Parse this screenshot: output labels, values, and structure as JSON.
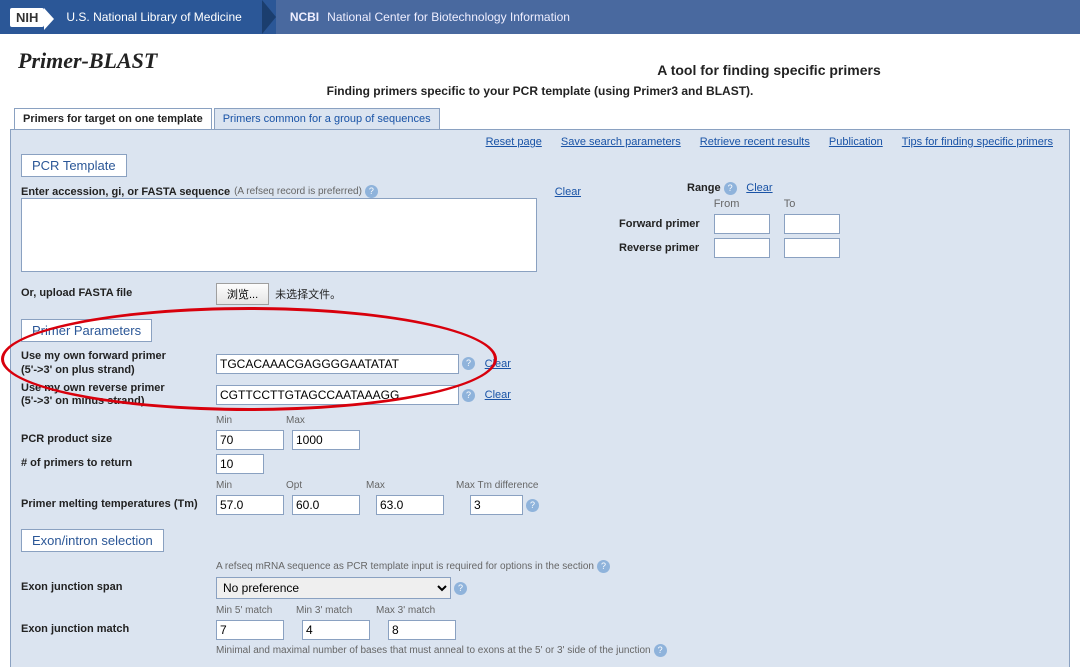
{
  "topbar": {
    "nih": "NIH",
    "nlm": "U.S. National Library of Medicine",
    "ncbi_bold": "NCBI",
    "ncbi": "National Center for Biotechnology Information"
  },
  "page": {
    "title": "Primer-BLAST",
    "subtitle": "A tool for finding specific primers",
    "tagline": "Finding primers specific to your PCR template (using Primer3 and BLAST)."
  },
  "tabs": {
    "active": "Primers for target on one template",
    "other": "Primers common for a group of sequences"
  },
  "quicklinks": [
    "Reset page",
    "Save search parameters",
    "Retrieve recent results",
    "Publication",
    "Tips for finding specific primers"
  ],
  "sections": {
    "pcr_template": "PCR Template",
    "primer_params": "Primer Parameters",
    "exon": "Exon/intron selection"
  },
  "template": {
    "label": "Enter accession, gi, or FASTA sequence",
    "hint": "(A refseq record is preferred)",
    "clear": "Clear",
    "upload_label": "Or, upload FASTA file",
    "browse": "浏览...",
    "nofile": "未选择文件。",
    "range_label": "Range",
    "range_clear": "Clear",
    "from": "From",
    "to": "To",
    "fwd": "Forward primer",
    "rev": "Reverse primer"
  },
  "primers": {
    "fwd_label": "Use my own forward primer\n(5'->3' on plus strand)",
    "rev_label": "Use my own reverse primer\n(5'->3' on minus strand)",
    "fwd_value": "TGCACAAACGAGGGGAATATAT",
    "rev_value": "CGTTCCTTGTAGCCAATAAAGG",
    "clear": "Clear",
    "size_label": "PCR product size",
    "min": "Min",
    "max": "Max",
    "size_min": "70",
    "size_max": "1000",
    "count_label": "# of primers to return",
    "count": "10",
    "tm_label": "Primer melting temperatures (Tm)",
    "opt": "Opt",
    "maxdiff": "Max Tm difference",
    "tm_min": "57.0",
    "tm_opt": "60.0",
    "tm_max": "63.0",
    "tm_diff": "3"
  },
  "exon": {
    "note": "A refseq mRNA sequence as PCR template input is required for options in the section",
    "span_label": "Exon junction span",
    "span_value": "No preference",
    "match_label": "Exon junction match",
    "min5": "Min 5' match",
    "min3": "Min 3' match",
    "max3": "Max 3' match",
    "v5": "7",
    "v3": "4",
    "vmax3": "8",
    "footnote": "Minimal and maximal number of bases that must anneal to exons at the 5' or 3' side of the junction"
  }
}
